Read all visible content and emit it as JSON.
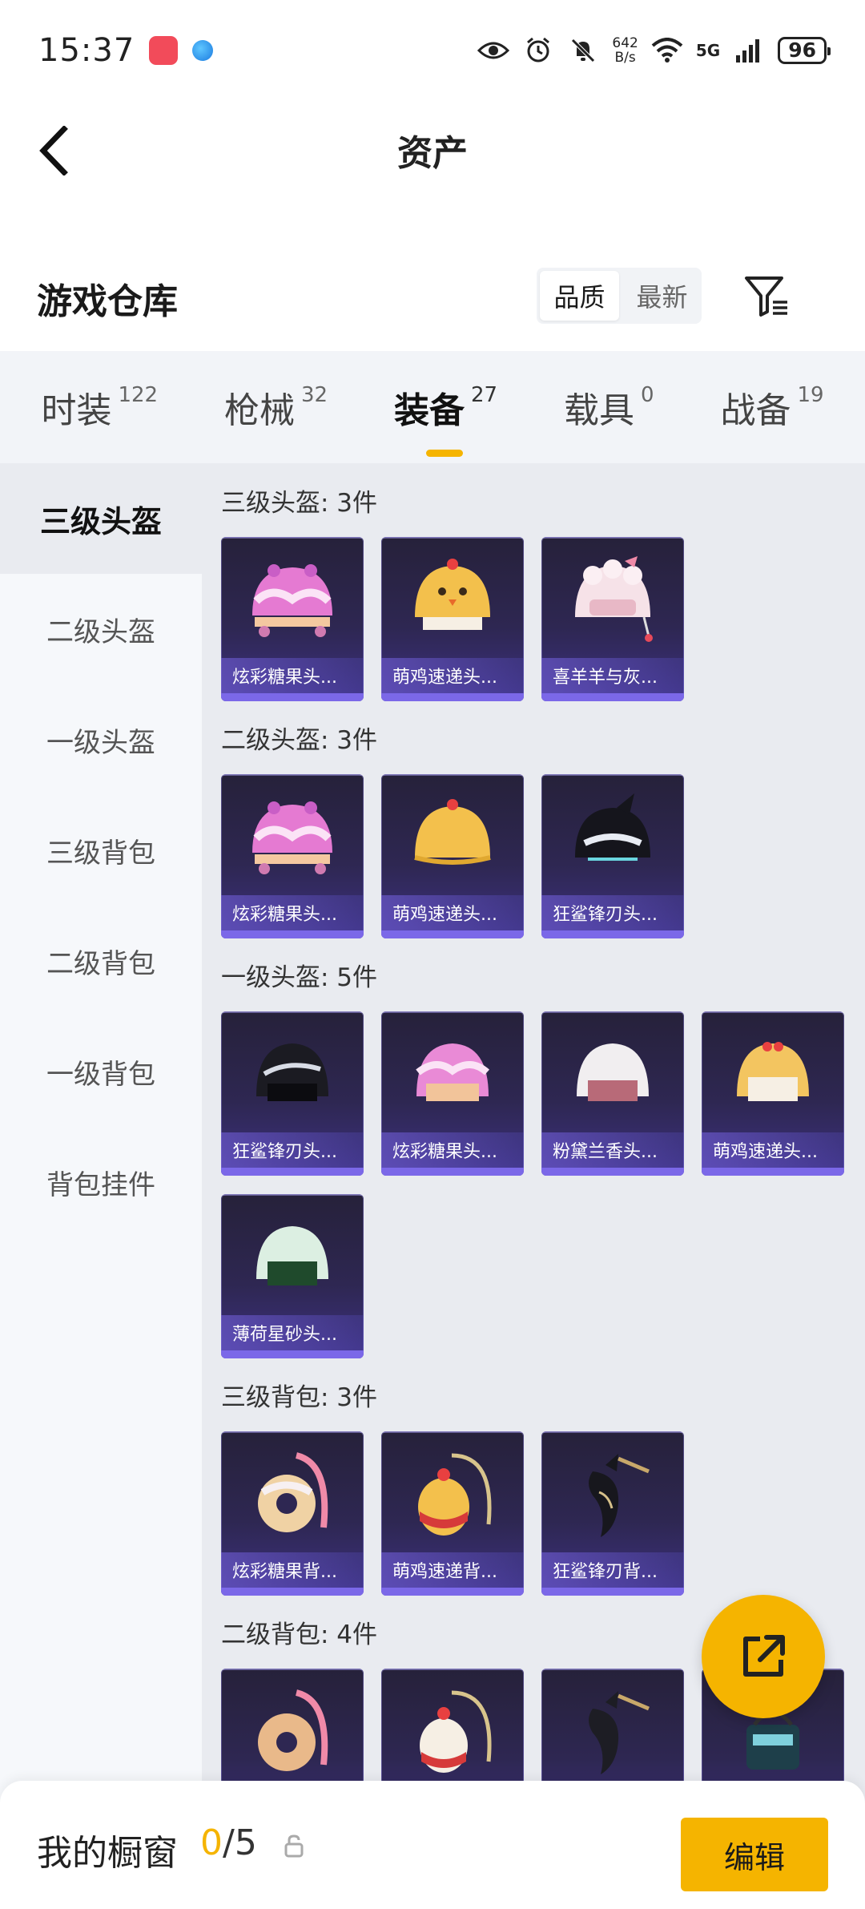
{
  "status_bar": {
    "time": "15:37",
    "net_speed_value": "642",
    "net_speed_unit": "B/s",
    "network_label": "5G",
    "battery": "96"
  },
  "header": {
    "title": "资产"
  },
  "warehouse": {
    "title": "游戏仓库",
    "sort_options": [
      "品质",
      "最新"
    ],
    "active_sort": "品质"
  },
  "tabs": [
    {
      "label": "时装",
      "count": "122"
    },
    {
      "label": "枪械",
      "count": "32"
    },
    {
      "label": "装备",
      "count": "27"
    },
    {
      "label": "载具",
      "count": "0"
    },
    {
      "label": "战备",
      "count": "19"
    }
  ],
  "active_tab": "装备",
  "sidebar": {
    "items": [
      "三级头盔",
      "二级头盔",
      "一级头盔",
      "三级背包",
      "二级背包",
      "一级背包",
      "背包挂件"
    ],
    "active": "三级头盔"
  },
  "sections": [
    {
      "title": "三级头盔: 3件",
      "items": [
        {
          "name": "炫彩糖果头...",
          "icon": "pink-candy-helmet-icon"
        },
        {
          "name": "萌鸡速递头...",
          "icon": "chick-helmet-icon"
        },
        {
          "name": "喜羊羊与灰...",
          "icon": "sheep-helmet-icon"
        }
      ]
    },
    {
      "title": "二级头盔: 3件",
      "items": [
        {
          "name": "炫彩糖果头...",
          "icon": "pink-candy-helmet-icon"
        },
        {
          "name": "萌鸡速递头...",
          "icon": "chick-helmet-icon"
        },
        {
          "name": "狂鲨锋刃头...",
          "icon": "shark-helmet-icon"
        }
      ]
    },
    {
      "title": "一级头盔: 5件",
      "items": [
        {
          "name": "狂鲨锋刃头...",
          "icon": "shark-helmet-icon"
        },
        {
          "name": "炫彩糖果头...",
          "icon": "pink-candy-helmet-icon"
        },
        {
          "name": "粉黛兰香头...",
          "icon": "white-helmet-icon"
        },
        {
          "name": "萌鸡速递头...",
          "icon": "chick-helmet-icon"
        },
        {
          "name": "薄荷星砂头...",
          "icon": "mint-helmet-icon"
        }
      ]
    },
    {
      "title": "三级背包: 3件",
      "items": [
        {
          "name": "炫彩糖果背...",
          "icon": "donut-backpack-icon"
        },
        {
          "name": "萌鸡速递背...",
          "icon": "chick-backpack-icon"
        },
        {
          "name": "狂鲨锋刃背...",
          "icon": "shark-backpack-icon"
        }
      ]
    },
    {
      "title": "二级背包: 4件",
      "items": [
        {
          "name": "",
          "icon": "donut-backpack-icon"
        },
        {
          "name": "",
          "icon": "chick-backpack-icon"
        },
        {
          "name": "",
          "icon": "shark-backpack-icon"
        },
        {
          "name": "",
          "icon": "teal-backpack-icon"
        }
      ]
    }
  ],
  "showcase": {
    "title": "我的橱窗",
    "current": "0",
    "total": "/5",
    "edit_label": "编辑"
  },
  "colors": {
    "accent": "#f5b400",
    "card_bg": "#2e2752",
    "content_bg": "#e9ebf0"
  }
}
